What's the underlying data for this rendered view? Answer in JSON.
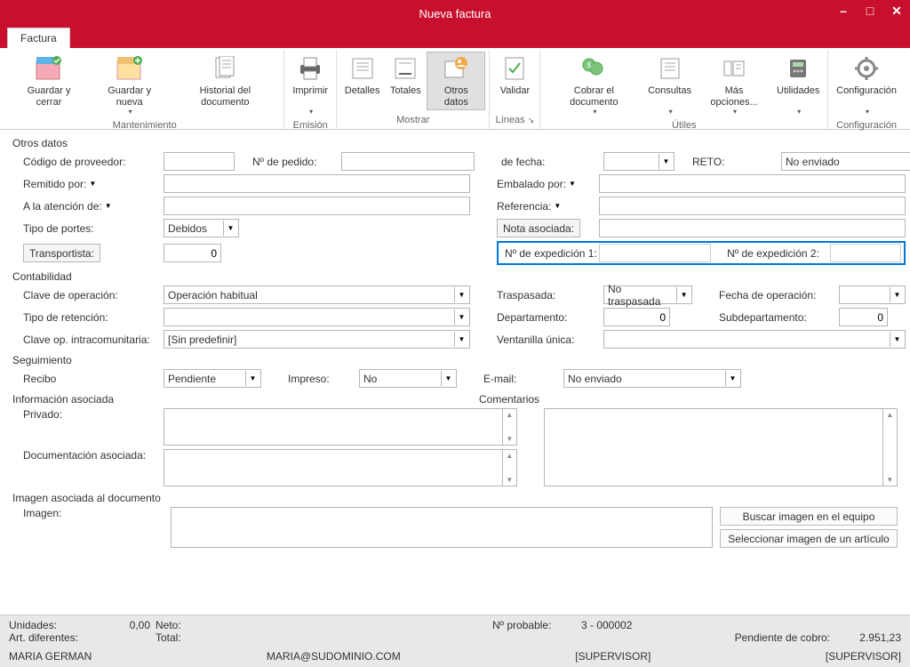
{
  "window": {
    "title": "Nueva factura"
  },
  "tab": {
    "label": "Factura"
  },
  "ribbon": {
    "guardar_cerrar": "Guardar y cerrar",
    "guardar_nueva": "Guardar y nueva",
    "historial": "Historial del documento",
    "imprimir": "Imprimir",
    "detalles": "Detalles",
    "totales": "Totales",
    "otros_datos": "Otros datos",
    "validar": "Validar",
    "lineas": "Líneas",
    "cobrar": "Cobrar el documento",
    "consultas": "Consultas",
    "mas_opciones": "Más opciones...",
    "utilidades": "Utilidades",
    "configuracion": "Configuración",
    "grp_mantenimiento": "Mantenimiento",
    "grp_emision": "Emisión",
    "grp_mostrar": "Mostrar",
    "grp_lineas": "Líneas",
    "grp_utiles": "Útiles",
    "grp_config": "Configuración"
  },
  "sections": {
    "otros_datos": "Otros datos",
    "contabilidad": "Contabilidad",
    "seguimiento": "Seguimiento",
    "info_asociada": "Información asociada",
    "imagen_asociada": "Imagen asociada al documento"
  },
  "labels": {
    "codigo_proveedor": "Código de proveedor:",
    "n_pedido": "Nº de pedido:",
    "de_fecha": "de fecha:",
    "reto": "RETO:",
    "remitido_por": "Remitido por:",
    "embalado_por": "Embalado por:",
    "atencion_de": "A la atención de:",
    "referencia": "Referencia:",
    "tipo_portes": "Tipo de portes:",
    "nota_asociada": "Nota asociada:",
    "transportista": "Transportista:",
    "n_exp1": "Nº de expedición 1:",
    "n_exp2": "Nº de expedición 2:",
    "clave_operacion": "Clave de operación:",
    "traspasada": "Traspasada:",
    "fecha_operacion": "Fecha de operación:",
    "tipo_retencion": "Tipo de retención:",
    "departamento": "Departamento:",
    "subdepartamento": "Subdepartamento:",
    "clave_intra": "Clave op. intracomunitaria:",
    "ventanilla": "Ventanilla única:",
    "recibo": "Recibo",
    "impreso": "Impreso:",
    "email": "E-mail:",
    "privado": "Privado:",
    "comentarios": "Comentarios",
    "doc_asociada": "Documentación asociada:",
    "imagen": "Imagen:",
    "buscar_img": "Buscar imagen en el equipo",
    "sel_img": "Seleccionar imagen de un artículo"
  },
  "values": {
    "reto": "No enviado",
    "tipo_portes": "Debidos",
    "transportista": "0",
    "clave_operacion": "Operación habitual",
    "traspasada": "No traspasada",
    "departamento": "0",
    "subdepartamento": "0",
    "clave_intra": "[Sin predefinir]",
    "recibo": "Pendiente",
    "impreso": "No",
    "email": "No enviado"
  },
  "status": {
    "unidades_lbl": "Unidades:",
    "unidades_val": "0,00",
    "neto_lbl": "Neto:",
    "art_dif_lbl": "Art. diferentes:",
    "total_lbl": "Total:",
    "n_probable_lbl": "Nº probable:",
    "n_probable_val": "3 - 000002",
    "pendiente_lbl": "Pendiente de cobro:",
    "pendiente_val": "2.951,23",
    "user": "MARIA GERMAN",
    "email": "MARIA@SUDOMINIO.COM",
    "role": "[SUPERVISOR]"
  }
}
